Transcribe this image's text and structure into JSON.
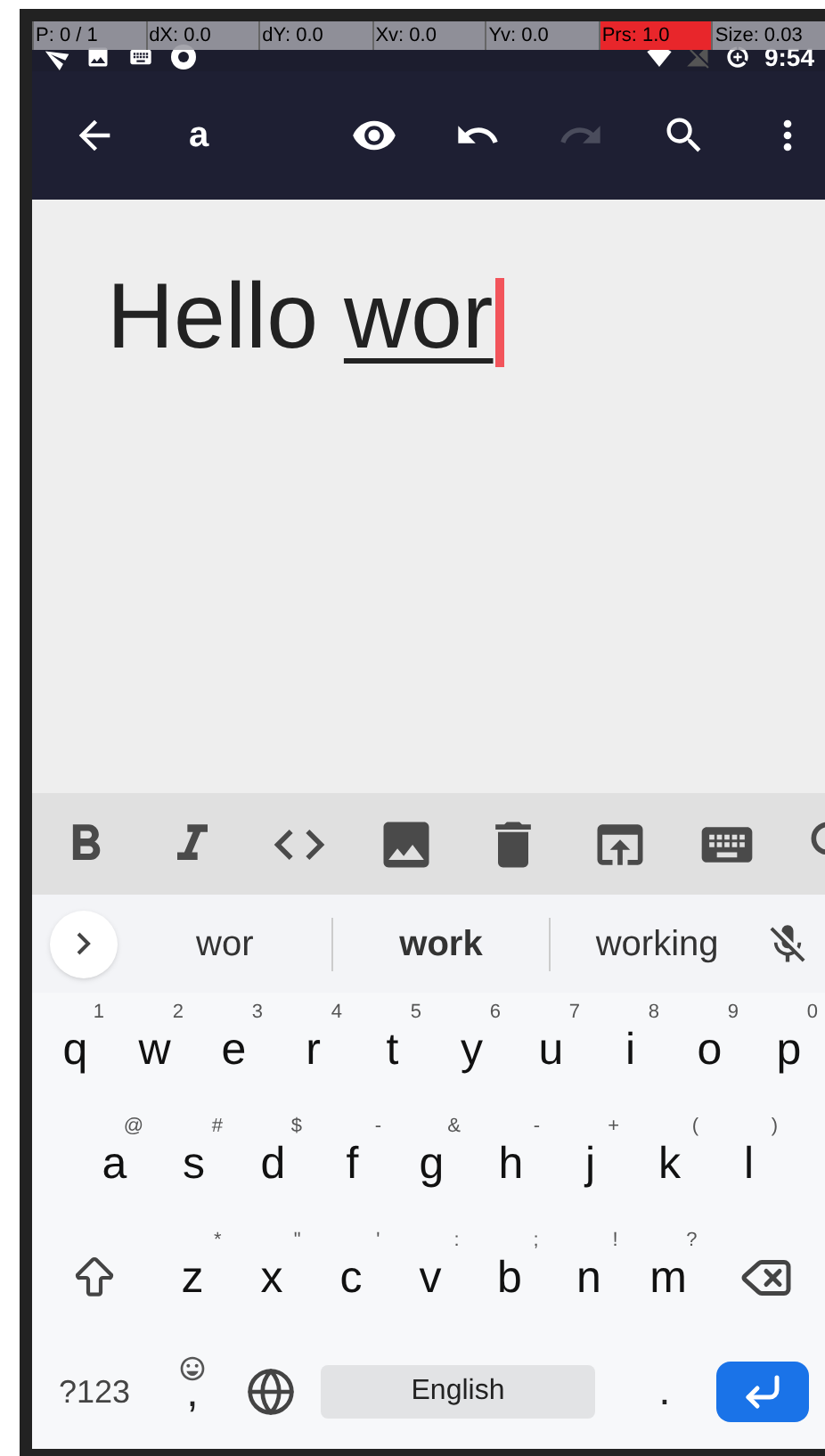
{
  "debug_overlay": [
    {
      "text": "P: 0 / 1",
      "highlighted": false
    },
    {
      "text": "dX: 0.0",
      "highlighted": false
    },
    {
      "text": "dY: 0.0",
      "highlighted": false
    },
    {
      "text": "Xv: 0.0",
      "highlighted": false
    },
    {
      "text": "Yv: 0.0",
      "highlighted": false
    },
    {
      "text": "Prs: 1.0",
      "highlighted": true
    },
    {
      "text": "Size: 0.03",
      "highlighted": false
    }
  ],
  "status_bar": {
    "time": "9:54"
  },
  "toolbar": {
    "title": "a",
    "actions": [
      {
        "kind": "preview",
        "disabled": false
      },
      {
        "kind": "undo",
        "disabled": false
      },
      {
        "kind": "redo",
        "disabled": true
      },
      {
        "kind": "search",
        "disabled": false
      },
      {
        "kind": "more",
        "disabled": false
      }
    ]
  },
  "editor": {
    "text": "Hello ",
    "composing": "wor"
  },
  "format_bar": [
    {
      "kind": "bold"
    },
    {
      "kind": "italic"
    },
    {
      "kind": "code"
    },
    {
      "kind": "image"
    },
    {
      "kind": "delete"
    },
    {
      "kind": "upload"
    },
    {
      "kind": "keyboard"
    },
    {
      "kind": "search"
    }
  ],
  "suggestions": [
    {
      "text": "wor",
      "selected": false
    },
    {
      "text": "work",
      "selected": true
    },
    {
      "text": "working",
      "selected": false
    }
  ],
  "keyboard": {
    "rows": [
      [
        {
          "key": "q",
          "hint": "1"
        },
        {
          "key": "w",
          "hint": "2"
        },
        {
          "key": "e",
          "hint": "3"
        },
        {
          "key": "r",
          "hint": "4"
        },
        {
          "key": "t",
          "hint": "5"
        },
        {
          "key": "y",
          "hint": "6"
        },
        {
          "key": "u",
          "hint": "7"
        },
        {
          "key": "i",
          "hint": "8"
        },
        {
          "key": "o",
          "hint": "9"
        },
        {
          "key": "p",
          "hint": "0"
        }
      ],
      [
        {
          "key": "a",
          "hint": "@"
        },
        {
          "key": "s",
          "hint": "#"
        },
        {
          "key": "d",
          "hint": "$"
        },
        {
          "key": "f",
          "hint": "-"
        },
        {
          "key": "g",
          "hint": "&"
        },
        {
          "key": "h",
          "hint": "-"
        },
        {
          "key": "j",
          "hint": "+"
        },
        {
          "key": "k",
          "hint": "("
        },
        {
          "key": "l",
          "hint": ")"
        }
      ],
      [
        {
          "key": "z",
          "hint": "*"
        },
        {
          "key": "x",
          "hint": "\""
        },
        {
          "key": "c",
          "hint": "'"
        },
        {
          "key": "v",
          "hint": ":"
        },
        {
          "key": "b",
          "hint": ";"
        },
        {
          "key": "n",
          "hint": "!"
        },
        {
          "key": "m",
          "hint": "?"
        }
      ]
    ],
    "symbols_key": "?123",
    "comma_key": ",",
    "space_label": "English",
    "period_key": "."
  }
}
